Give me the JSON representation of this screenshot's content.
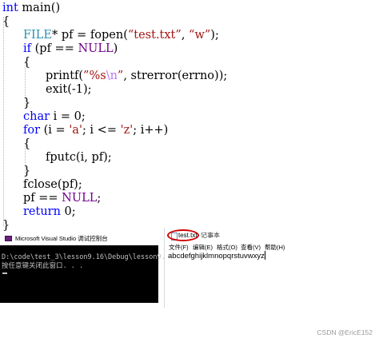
{
  "code": {
    "line1": {
      "kw": "int",
      "rest": " main()"
    },
    "line2": {
      "text": "{"
    },
    "line3": {
      "type": "FILE",
      "a": "* pf = fopen(",
      "s1": "“test.txt”",
      "b": ", ",
      "s2": "“w”",
      "c": ");"
    },
    "line4": {
      "kw": "if",
      "a": " (pf == ",
      "mac": "NULL",
      "b": ")"
    },
    "line5": {
      "text": "{"
    },
    "line6": {
      "a": "printf(",
      "s1": "”%s",
      "esc": "\\n",
      "s2": "”",
      "b": ", strerror(errno));"
    },
    "line7": {
      "text": "exit(-1);"
    },
    "line8": {
      "text": "}"
    },
    "line9": {
      "kw": "char",
      "rest": " i = 0;"
    },
    "line10": {
      "kw": "for",
      "a": " (i = ",
      "s1": "'a'",
      "b": "; i <= ",
      "s2": "'z'",
      "c": "; i++)"
    },
    "line11": {
      "text": "{"
    },
    "line12": {
      "text": "fputc(i, pf);"
    },
    "line13": {
      "text": "}"
    },
    "line14": {
      "text": "fclose(pf);"
    },
    "line15": {
      "a": "pf == ",
      "mac": "NULL",
      "b": ";"
    },
    "line16": {
      "kw": "return",
      "rest": " 0;"
    },
    "line17": {
      "text": "}"
    }
  },
  "console": {
    "title": "Microsoft Visual Studio 调试控制台",
    "line1": "D:\\code\\test_3\\lesson9.16\\Debug\\lesson9.16.exe",
    "line2": "按任意键关闭此窗口. . ."
  },
  "notepad": {
    "title": "test.txt",
    "app_suffix": "记事本",
    "menu": [
      "文件(F)",
      "编辑(E)",
      "格式(O)",
      "查看(V)",
      "帮助(H)"
    ],
    "content": "abcdefghijklmnopqrstuvwxyz"
  },
  "watermark": "CSDN @EricE152"
}
